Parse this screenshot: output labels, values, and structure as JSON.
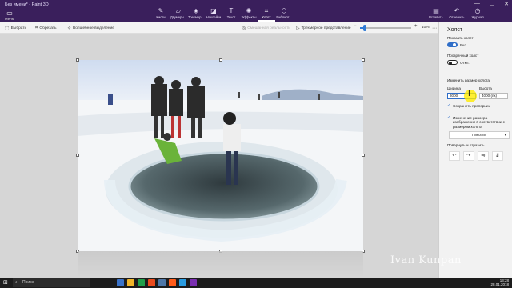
{
  "window": {
    "title": "Без имени* - Paint 3D",
    "controls": [
      "—",
      "☐",
      "✕"
    ]
  },
  "ribbon": {
    "menu": {
      "icon": "folder-icon",
      "label": "Меню"
    },
    "tools": [
      {
        "label": "Кисти",
        "icon": "brush-icon",
        "active": false
      },
      {
        "label": "Двумерн...",
        "icon": "shapes2d-icon",
        "active": false
      },
      {
        "label": "Трехмер...",
        "icon": "shapes3d-icon",
        "active": false
      },
      {
        "label": "Наклейки",
        "icon": "sticker-icon",
        "active": false
      },
      {
        "label": "Текст",
        "icon": "text-icon",
        "active": false
      },
      {
        "label": "Эффекты",
        "icon": "effects-icon",
        "active": false
      },
      {
        "label": "Холст",
        "icon": "canvas-icon",
        "active": true
      },
      {
        "label": "Библиот...",
        "icon": "library-icon",
        "active": false
      }
    ],
    "right": [
      {
        "label": "Вставить",
        "icon": "paste-icon"
      },
      {
        "label": "Отменить",
        "icon": "undo-icon"
      },
      {
        "label": "Журнал",
        "icon": "history-icon"
      }
    ]
  },
  "commandbar": {
    "select": "Выбрать",
    "crop": "Обрезать",
    "magic_select": "Волшебное выделение",
    "mixed_reality": "Смешанная реальность",
    "perspective": "Трехмерное представление",
    "zoom_value": "10%",
    "zoom_fraction": 0.1
  },
  "panel": {
    "title": "Холст",
    "show_canvas_label": "Показать холст",
    "show_canvas_state": "Вкл.",
    "transparent_label": "Прозрачный холст",
    "transparent_state": "Откл.",
    "resize_label": "Изменить размер холста",
    "width_label": "Ширина",
    "height_label": "Высота",
    "width_value": "3000",
    "height_value": "4000 (пк)",
    "keep_ratio": "Сохранить пропорции",
    "resize_image": "Изменение размера изображения в соответствии с размером холста",
    "units": "Пиксели",
    "rotate_label": "Повернуть и отразить",
    "rotate_buttons": [
      "↶",
      "↷",
      "⇋",
      "⇵"
    ]
  },
  "taskbar": {
    "search_placeholder": "Поиск",
    "time": "13:28",
    "date": "28.01.2018"
  },
  "watermark": "Ivan Kunpan"
}
